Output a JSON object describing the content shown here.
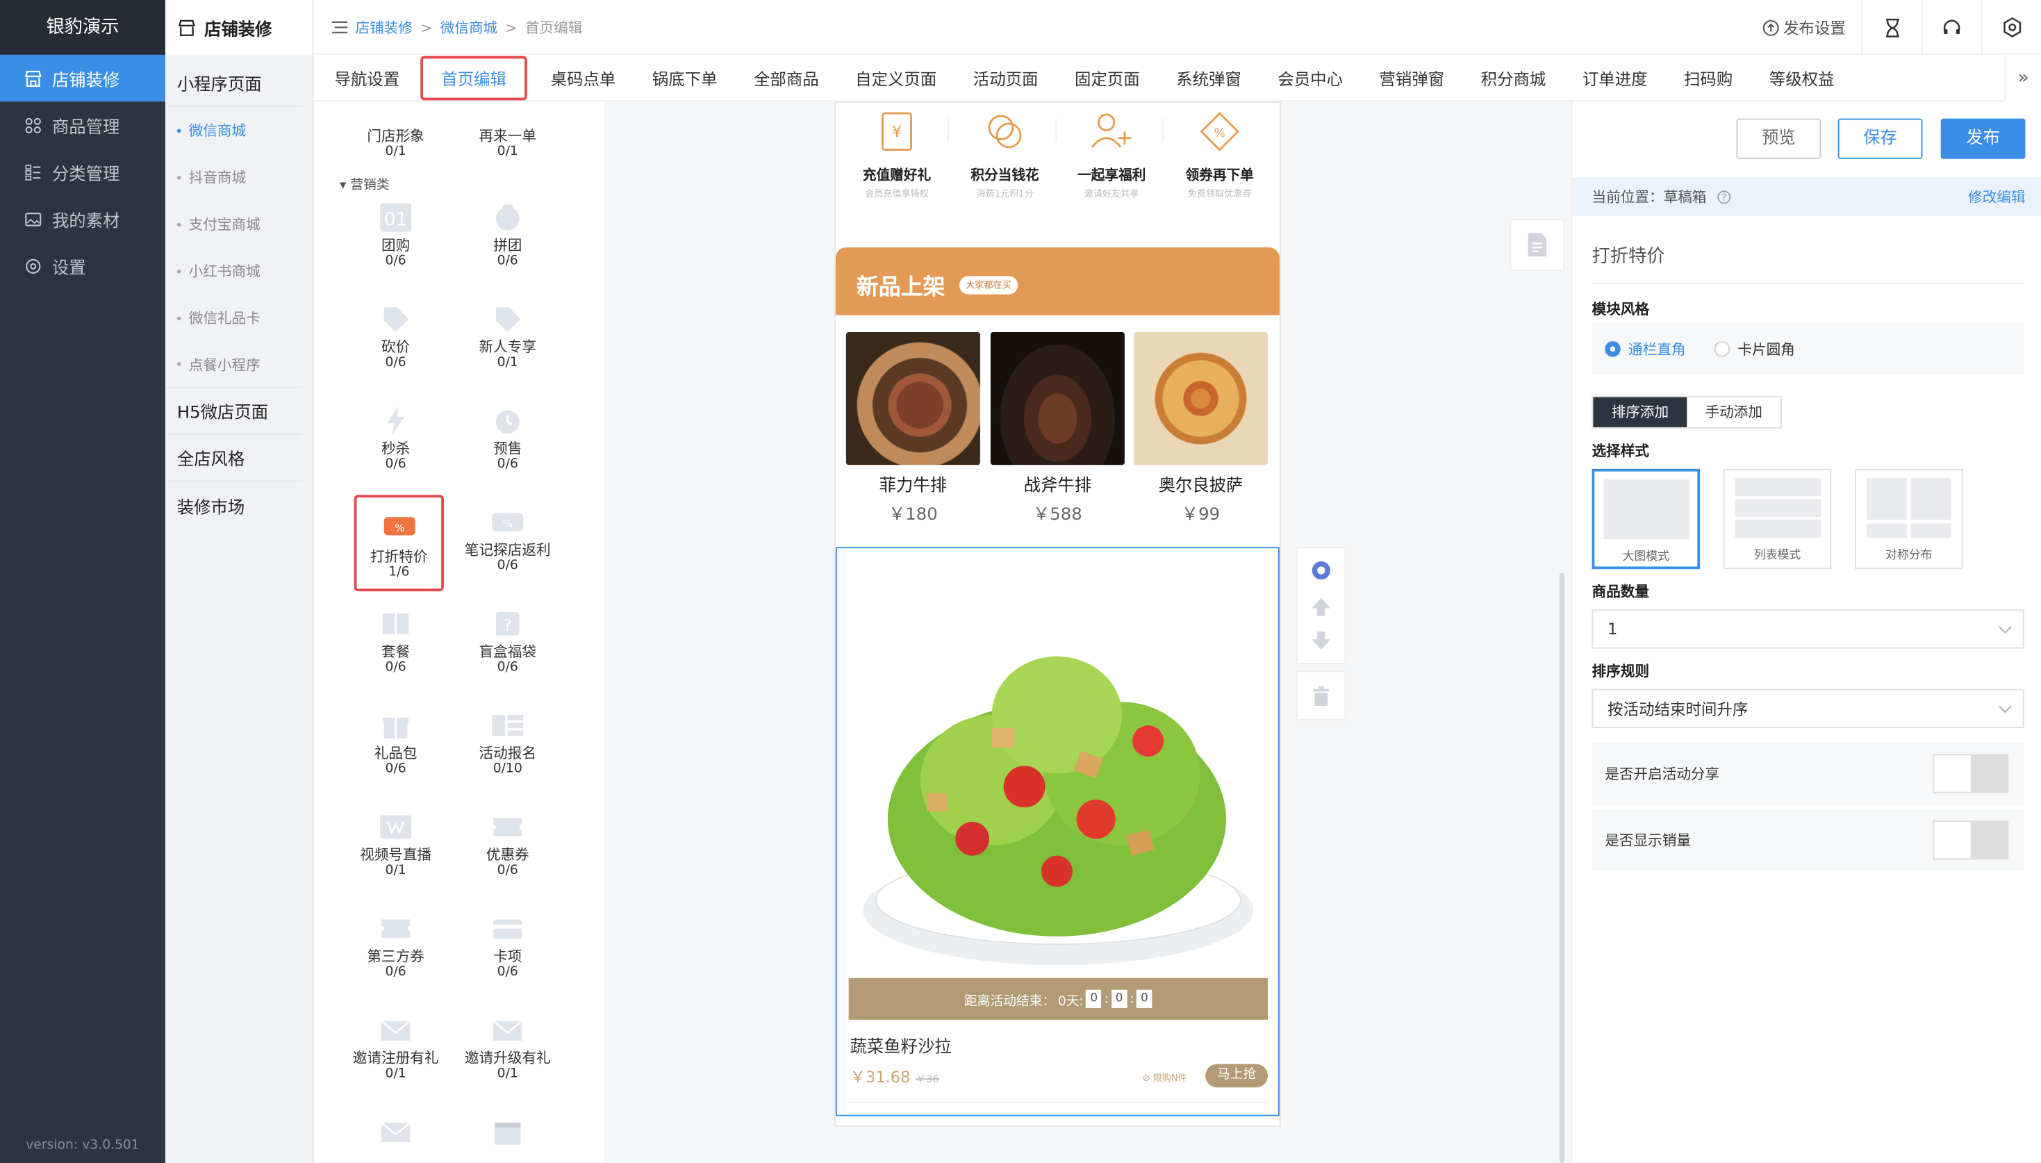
{
  "app": {
    "brand": "银豹演示",
    "version": "version: v3.0.501"
  },
  "sidebar": {
    "items": [
      {
        "label": "店铺装修",
        "icon": "store-icon",
        "active": true
      },
      {
        "label": "商品管理",
        "icon": "grid-icon"
      },
      {
        "label": "分类管理",
        "icon": "list-icon"
      },
      {
        "label": "我的素材",
        "icon": "image-icon"
      },
      {
        "label": "设置",
        "icon": "gear-icon"
      }
    ]
  },
  "submenu": {
    "title": "店铺装修",
    "groups": {
      "miniapp": "小程序页面",
      "children": [
        "微信商城",
        "抖音商城",
        "支付宝商城",
        "小红书商城",
        "微信礼品卡",
        "点餐小程序"
      ],
      "h5": "H5微店页面",
      "style": "全店风格",
      "market": "装修市场"
    }
  },
  "breadcrumb": {
    "l1": "店铺装修",
    "l2": "微信商城",
    "l3": "首页编辑",
    "sep": ">"
  },
  "topbar": {
    "publish_settings": "发布设置"
  },
  "tabs": [
    "导航设置",
    "首页编辑",
    "桌码点单",
    "锅底下单",
    "全部商品",
    "自定义页面",
    "活动页面",
    "固定页面",
    "系统弹窗",
    "会员中心",
    "营销弹窗",
    "积分商城",
    "订单进度",
    "扫码购",
    "等级权益"
  ],
  "palette": {
    "category": "营销类",
    "items": [
      {
        "label": "门店形象",
        "count": "0/1"
      },
      {
        "label": "再来一单",
        "count": "0/1"
      },
      {
        "label": "团购",
        "count": "0/6"
      },
      {
        "label": "拼团",
        "count": "0/6"
      },
      {
        "label": "砍价",
        "count": "0/6"
      },
      {
        "label": "新人专享",
        "count": "0/1"
      },
      {
        "label": "秒杀",
        "count": "0/6"
      },
      {
        "label": "预售",
        "count": "0/6"
      },
      {
        "label": "打折特价",
        "count": "1/6"
      },
      {
        "label": "笔记探店返利",
        "count": "0/6"
      },
      {
        "label": "套餐",
        "count": "0/6"
      },
      {
        "label": "盲盒福袋",
        "count": "0/6"
      },
      {
        "label": "礼品包",
        "count": "0/6"
      },
      {
        "label": "活动报名",
        "count": "0/10"
      },
      {
        "label": "视频号直播",
        "count": "0/1"
      },
      {
        "label": "优惠券",
        "count": "0/6"
      },
      {
        "label": "第三方券",
        "count": "0/6"
      },
      {
        "label": "卡项",
        "count": "0/6"
      },
      {
        "label": "邀请注册有礼",
        "count": "0/1"
      },
      {
        "label": "邀请升级有礼",
        "count": "0/1"
      }
    ]
  },
  "phone": {
    "shortcuts": [
      {
        "title": "充值赠好礼",
        "sub": "会员充值享特权"
      },
      {
        "title": "积分当钱花",
        "sub": "消费1元积1分"
      },
      {
        "title": "一起享福利",
        "sub": "邀请好友共享"
      },
      {
        "title": "领券再下单",
        "sub": "免费领取优惠券"
      }
    ],
    "banner_title": "新品上架",
    "banner_badge": "大家都在买",
    "products": [
      {
        "name": "菲力牛排",
        "price": "￥180"
      },
      {
        "name": "战斧牛排",
        "price": "￥588"
      },
      {
        "name": "奥尔良披萨",
        "price": "￥99"
      }
    ],
    "deal": {
      "timer_label": "距离活动结束：",
      "timer_days": "0天:",
      "timer_h": "0",
      "timer_m": "0",
      "timer_s": "0",
      "name": "蔬菜鱼籽沙拉",
      "price": "￥31.68",
      "orig": "￥36",
      "limit": "限购N件",
      "buy": "马上抢"
    }
  },
  "panel": {
    "preview": "预览",
    "save": "保存",
    "publish": "发布",
    "location_label": "当前位置：草稿箱",
    "edit_link": "修改编辑",
    "title": "打折特价",
    "module_style": "模块风格",
    "style_a": "通栏直角",
    "style_b": "卡片圆角",
    "seg_a": "排序添加",
    "seg_b": "手动添加",
    "choose_style": "选择样式",
    "cards": [
      "大图模式",
      "列表模式",
      "对称分布"
    ],
    "qty_label": "商品数量",
    "qty_value": "1",
    "sort_label": "排序规则",
    "sort_value": "按活动结束时间升序",
    "share_label": "是否开启活动分享",
    "sales_label": "是否显示销量"
  },
  "colors": {
    "accent": "#3a8ee6",
    "sidebar": "#2e3340",
    "highlight": "#e6454a",
    "banner": "#e29a55",
    "gold": "#b39a77"
  }
}
